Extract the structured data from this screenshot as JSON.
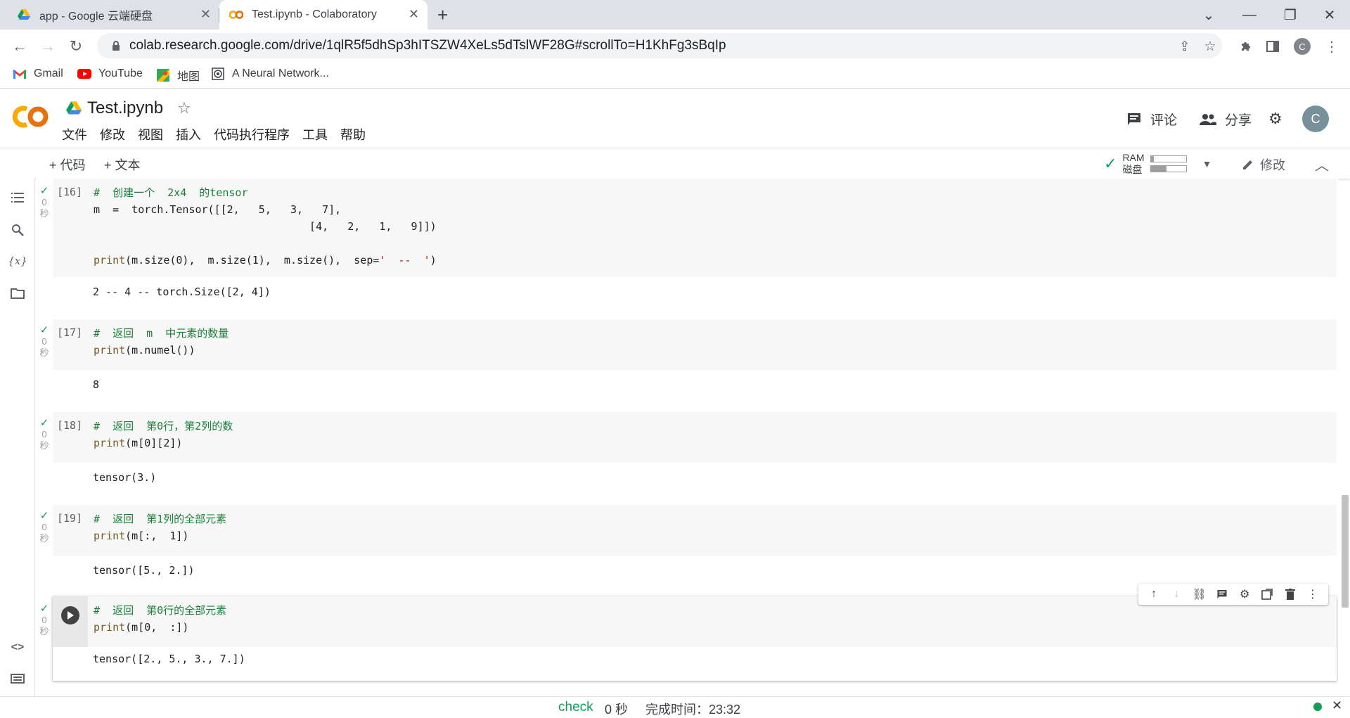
{
  "browser": {
    "tabs": [
      {
        "title": "app - Google 云端硬盘",
        "active": false
      },
      {
        "title": "Test.ipynb - Colaboratory",
        "active": true
      }
    ],
    "url": "colab.research.google.com/drive/1qlR5f5dhSp3hITSZW4XeLs5dTslWF28G#scrollTo=H1KhFg3sBqIp",
    "profile_initial": "C",
    "bookmarks": [
      {
        "label": "Gmail",
        "icon": "gmail-icon"
      },
      {
        "label": "YouTube",
        "icon": "youtube-icon"
      },
      {
        "label": "地图",
        "icon": "maps-icon"
      },
      {
        "label": "A Neural Network...",
        "icon": "neural-network-icon"
      }
    ]
  },
  "colab": {
    "title": "Test.ipynb",
    "menu": [
      "文件",
      "修改",
      "视图",
      "插入",
      "代码执行程序",
      "工具",
      "帮助"
    ],
    "comment_label": "评论",
    "share_label": "分享",
    "avatar_initial": "C",
    "add_code_label": "+ 代码",
    "add_text_label": "+ 文本",
    "ram_label": "RAM",
    "disk_label": "磁盘",
    "ram_usage": 0.08,
    "disk_usage": 0.45,
    "edit_label": "修改"
  },
  "cells": [
    {
      "count": "[16]",
      "status_time": "0",
      "status_unit": "秒",
      "output": "2 -- 4 -- torch.Size([2, 4])"
    },
    {
      "count": "[17]",
      "status_time": "0",
      "status_unit": "秒",
      "output": "8"
    },
    {
      "count": "[18]",
      "status_time": "0",
      "status_unit": "秒",
      "output": "tensor(3.)"
    },
    {
      "count": "[19]",
      "status_time": "0",
      "status_unit": "秒",
      "output": "tensor([5., 2.])"
    },
    {
      "count": "",
      "status_time": "0",
      "status_unit": "秒",
      "output": "tensor([2., 5., 3., 7.])"
    }
  ],
  "code": {
    "c16_l1": "#  创建一个  2x4  的tensor",
    "c16_l2a": "m  =  torch.Tensor([[2,   5,   3,   7],",
    "c16_l3": "                                  [4,   2,   1,   9]])",
    "c16_l5_fn": "print",
    "c16_l5_rest": "(m.size(0),  m.size(1),  m.size(),  sep=",
    "c16_l5_str": "'  --  '",
    "c16_l5_end": ")",
    "c17_l1": "#  返回  m  中元素的数量",
    "c17_l2_fn": "print",
    "c17_l2_rest": "(m.numel())",
    "c18_l1": "#  返回  第0行，第2列的数",
    "c18_l2_fn": "print",
    "c18_l2_rest": "(m[0][2])",
    "c19_l1": "#  返回  第1列的全部元素",
    "c19_l2_fn": "print",
    "c19_l2_rest": "(m[:,  1])",
    "c20_l1": "#  返回  第0行的全部元素",
    "c20_l2_fn": "print",
    "c20_l2_rest": "(m[0,  :])"
  },
  "statusbar": {
    "check": "check",
    "duration": "0 秒",
    "completed": "完成时间：23:32"
  },
  "colors": {
    "accent_green": "#0f9d58",
    "colab_orange": "#f9ab00",
    "comment_green": "#188038"
  }
}
